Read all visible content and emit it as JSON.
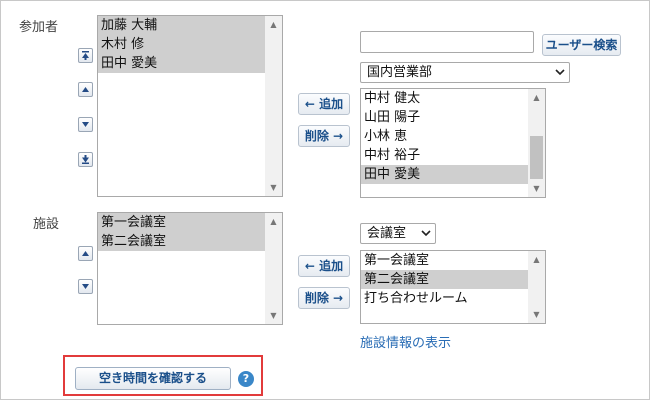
{
  "participants": {
    "label": "参加者",
    "selected_list": [
      "加藤 大輔",
      "木村 修",
      "田中 愛美"
    ],
    "order_buttons": [
      "move-top",
      "move-up",
      "move-down",
      "move-bottom"
    ],
    "add_label": "← 追加",
    "remove_label": "削除 →",
    "search_input_value": "",
    "search_button_label": "ユーザー検索",
    "group_select_value": "国内営業部",
    "candidates": [
      "中村 健太",
      "山田 陽子",
      "小林 恵",
      "中村 裕子",
      "田中 愛美"
    ],
    "candidates_selected": "田中 愛美"
  },
  "facilities": {
    "label": "施設",
    "selected_list": [
      "第一会議室",
      "第二会議室"
    ],
    "add_label": "← 追加",
    "remove_label": "削除 →",
    "category_select_value": "会議室",
    "candidates": [
      "第一会議室",
      "第二会議室",
      "打ち合わせルーム"
    ],
    "candidates_selected": "第二会議室",
    "info_link": "施設情報の表示"
  },
  "footer": {
    "check_availability_label": "空き時間を確認する",
    "help_icon_glyph": "?"
  },
  "colors": {
    "highlight": "#e23b3b",
    "accent": "#1a4f8a",
    "link": "#2a6db5",
    "selection": "#cfcfcf"
  }
}
